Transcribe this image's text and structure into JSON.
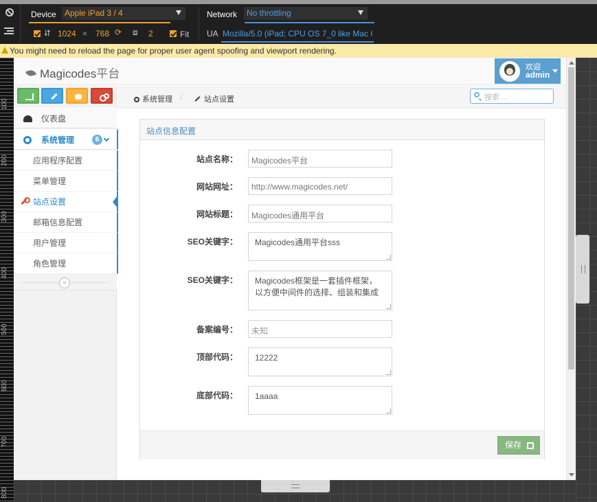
{
  "devtools": {
    "device_label": "Device",
    "device_value": "Apple iPad 3 / 4",
    "width": "1024",
    "times": "×",
    "height": "768",
    "scale": "2",
    "fit_label": "Fit",
    "network_label": "Network",
    "network_value": "No throttling",
    "ua_label": "UA",
    "ua_value": "Mozilla/5.0 (iPad; CPU OS 7_0 like Mac OS"
  },
  "warning": "You might need to reload the page for proper user agent spoofing and viewport rendering.",
  "rulers": [
    "100",
    "200",
    "300",
    "400",
    "500",
    "600",
    "700",
    "800"
  ],
  "navbar": {
    "brand_en": "Magicodes",
    "brand_cn": "平台",
    "welcome": "欢迎",
    "username": "admin"
  },
  "sidebar": {
    "dashboard": "仪表盘",
    "system": "系统管理",
    "system_badge": "6",
    "sub_items": [
      "应用程序配置",
      "菜单管理",
      "站点设置",
      "邮箱信息配置",
      "用户管理",
      "角色管理"
    ],
    "collapse": "«"
  },
  "breadcrumb": {
    "item1": "系统管理",
    "item2": "站点设置",
    "separator": "/"
  },
  "search": {
    "placeholder": "搜索 ..."
  },
  "form": {
    "title": "站点信息配置",
    "site_name_label": "站点名称：",
    "site_name_placeholder": "Magicodes平台",
    "site_url_label": "网站网址：",
    "site_url_placeholder": "http://www.magicodes.net/",
    "site_title_label": "网站标题：",
    "site_title_placeholder": "Magicodes通用平台",
    "seo_keywords_label": "SEO关键字：",
    "seo_keywords_value": "Magicodes通用平台sss",
    "seo_desc_label": "SEO关键字：",
    "seo_desc_value": "Magicodes框架是一套插件框架，以方便中间件的选择、组装和集成",
    "icp_label": "备案编号：",
    "icp_placeholder": "未知",
    "header_code_label": "顶部代码：",
    "header_code_value": "12222",
    "footer_code_label": "底部代码：",
    "footer_code_value": "1aaaa",
    "save_label": "保存"
  },
  "colors": {
    "devtools_accent": "#f0a030",
    "brand_blue": "#2a8bcc",
    "save_green": "#87b87f",
    "warning_bg": "#fbe9a7"
  }
}
